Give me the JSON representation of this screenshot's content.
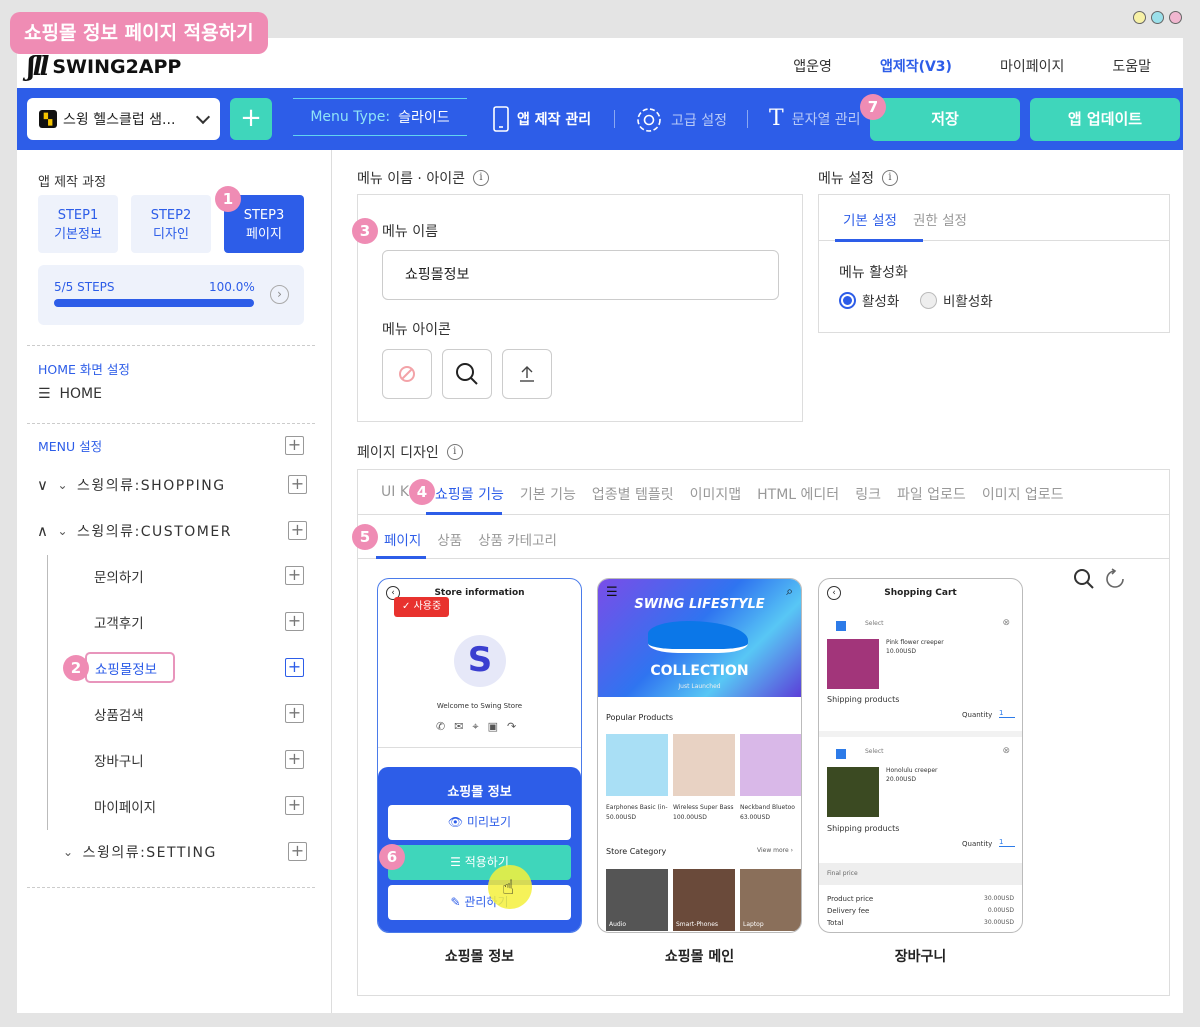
{
  "title_badge": "쇼핑몰 정보 페이지 적용하기",
  "header": {
    "logo": "SWING2APP",
    "nav": [
      "앱운영",
      "앱제작(V3)",
      "마이페이지",
      "도움말"
    ],
    "active_nav": "앱제작(V3)"
  },
  "toolbar": {
    "project": "스윙 헬스클럽 샘...",
    "menu_type_key": "Menu Type:",
    "menu_type_value": "슬라이드",
    "app_manage": "앱 제작 관리",
    "advanced": "고급 설정",
    "strings": "문자열 관리",
    "save": "저장",
    "update": "앱 업데이트"
  },
  "sidebar": {
    "process_title": "앱 제작 과정",
    "steps": [
      {
        "line1": "STEP1",
        "line2": "기본정보"
      },
      {
        "line1": "STEP2",
        "line2": "디자인"
      },
      {
        "line1": "STEP3",
        "line2": "페이지"
      }
    ],
    "progress_label": "5/5 STEPS",
    "progress_percent": "100.0%",
    "progress_value": 1.0,
    "home_title": "HOME 화면 설정",
    "home_item": "HOME",
    "menu_title": "MENU 설정",
    "groups": [
      "스윙의류:SHOPPING",
      "스윙의류:CUSTOMER",
      "스윙의류:SETTING"
    ],
    "sub_items": [
      "문의하기",
      "고객후기",
      "쇼핑몰정보",
      "상품검색",
      "장바구니",
      "마이페이지"
    ]
  },
  "menu_name_section": {
    "title": "메뉴 이름 · 아이콘",
    "name_label": "메뉴 이름",
    "name_value": "쇼핑몰정보",
    "icon_label": "메뉴 아이콘"
  },
  "menu_settings": {
    "title": "메뉴 설정",
    "tabs": [
      "기본 설정",
      "권한 설정"
    ],
    "activate_label": "메뉴 활성화",
    "options": [
      "활성화",
      "비활성화"
    ]
  },
  "page_design": {
    "title": "페이지 디자인",
    "tabs": [
      "UI K",
      "쇼핑몰 기능",
      "기본 기능",
      "업종별 템플릿",
      "이미지맵",
      "HTML 에디터",
      "링크",
      "파일 업로드",
      "이미지 업로드"
    ],
    "subtabs": [
      "페이지",
      "상품",
      "상품 카테고리"
    ]
  },
  "cards": [
    {
      "label": "쇼핑몰 정보",
      "header": "Store information",
      "in_use": "사용중",
      "welcome": "Welcome to Swing Store",
      "overlay_title": "쇼핑몰 정보",
      "preview": "미리보기",
      "apply": "적용하기",
      "manage": "관리하기"
    },
    {
      "label": "쇼핑몰 메인",
      "banner_title": "SWING LIFESTYLE",
      "banner_sub": "COLLECTION",
      "banner_small": "Just Launched",
      "popular": "Popular Products",
      "products": [
        {
          "name": "Earphones Basic (in-",
          "price": "50.00USD"
        },
        {
          "name": "Wireless Super Bass",
          "price": "100.00USD"
        },
        {
          "name": "Neckband Bluetoo",
          "price": "63.00USD"
        }
      ],
      "category": "Store Category",
      "view_more": "View more ›",
      "categories": [
        "Audio",
        "Smart-Phones",
        "Laptop"
      ]
    },
    {
      "label": "장바구니",
      "header": "Shopping Cart",
      "select": "Select",
      "item1": "Pink flower creeper",
      "price1": "10.00USD",
      "item2": "Honolulu creeper",
      "price2": "20.00USD",
      "shipping": "Shipping products",
      "quantity": "Quantity",
      "qty": "1",
      "final": "Final price",
      "product_price": "Product price",
      "product_price_val": "30.00USD",
      "delivery": "Delivery fee",
      "delivery_val": "0.00USD",
      "total": "Total",
      "total_val": "30.00USD"
    }
  ],
  "markers": [
    "1",
    "2",
    "3",
    "4",
    "5",
    "6",
    "7"
  ]
}
